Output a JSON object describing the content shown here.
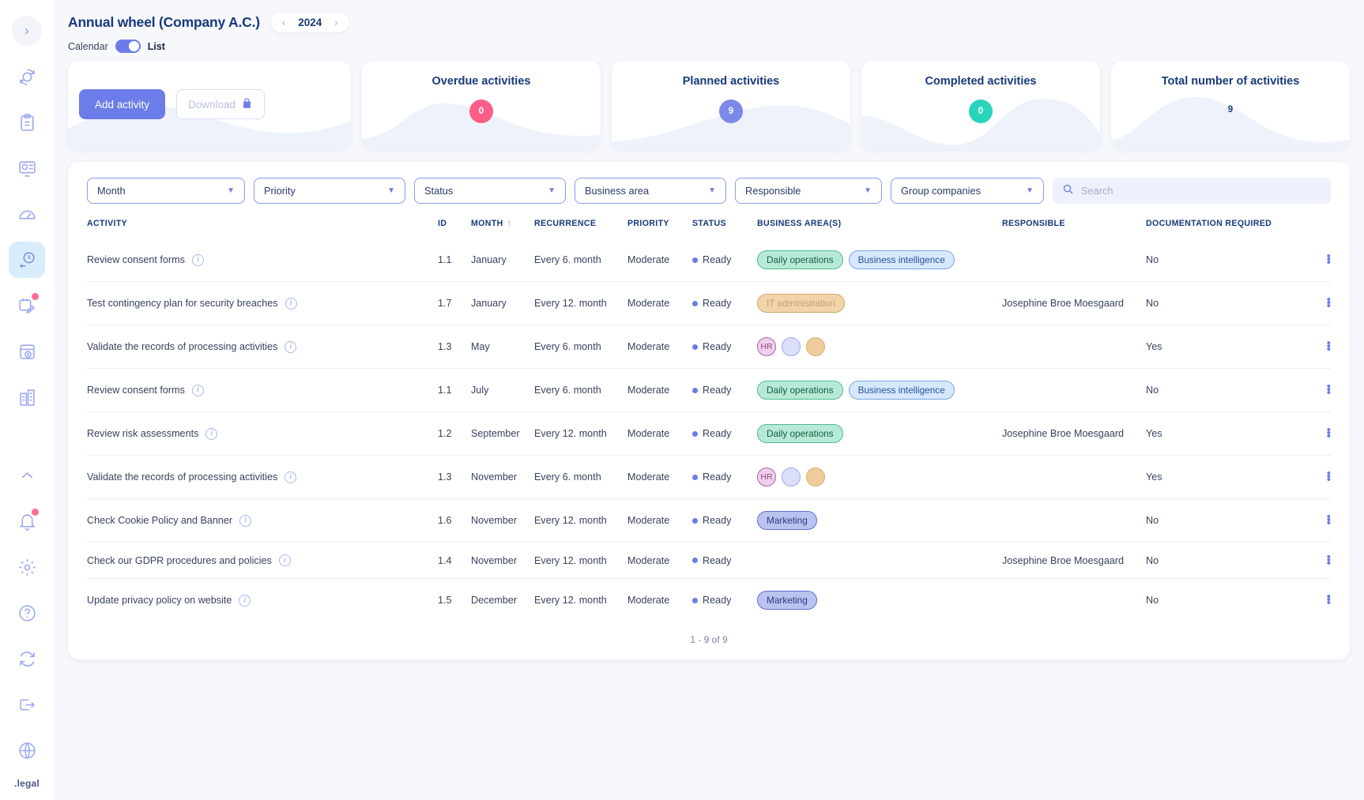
{
  "sidebar": {
    "collapse_label": "expand-sidebar",
    "items": [
      {
        "name": "sidebar-item-cycle",
        "icon": "refresh-globe-icon",
        "active": false,
        "badge": false
      },
      {
        "name": "sidebar-item-clipboard",
        "icon": "clipboard-icon",
        "active": false,
        "badge": false
      },
      {
        "name": "sidebar-item-dashboard",
        "icon": "monitor-chart-icon",
        "active": false,
        "badge": false
      },
      {
        "name": "sidebar-item-gauge",
        "icon": "gauge-icon",
        "active": false,
        "badge": false
      },
      {
        "name": "sidebar-item-annual-wheel",
        "icon": "clock-task-icon",
        "active": true,
        "badge": false
      },
      {
        "name": "sidebar-item-tasks",
        "icon": "calendar-edit-icon",
        "active": false,
        "badge": true
      },
      {
        "name": "sidebar-item-reports",
        "icon": "file-upload-icon",
        "active": false,
        "badge": false
      },
      {
        "name": "sidebar-item-company",
        "icon": "building-icon",
        "active": false,
        "badge": false
      }
    ],
    "bottom_items": [
      {
        "name": "sidebar-item-collapse-up",
        "icon": "chevron-up-icon",
        "badge": false
      },
      {
        "name": "sidebar-item-notifications",
        "icon": "bell-icon",
        "badge": true
      },
      {
        "name": "sidebar-item-settings",
        "icon": "gear-icon",
        "badge": false
      },
      {
        "name": "sidebar-item-help",
        "icon": "question-circle-icon",
        "badge": false
      },
      {
        "name": "sidebar-item-sync",
        "icon": "sync-icon",
        "badge": false
      },
      {
        "name": "sidebar-item-logout",
        "icon": "logout-icon",
        "badge": false
      },
      {
        "name": "sidebar-item-language",
        "icon": "globe-icon",
        "badge": false
      }
    ],
    "brand": ".legal"
  },
  "header": {
    "title": "Annual wheel (Company A.C.)",
    "year": "2024",
    "prev_arrow": "‹",
    "next_arrow": "›",
    "view_left_label": "Calendar",
    "view_right_label": "List"
  },
  "actions": {
    "add_activity": "Add activity",
    "download": "Download",
    "lock_icon": "lock-icon"
  },
  "stats": [
    {
      "title": "Overdue activities",
      "value": "0",
      "color": "#fb5f88",
      "style": "bubble"
    },
    {
      "title": "Planned activities",
      "value": "9",
      "color": "#7b8ae8",
      "style": "bubble"
    },
    {
      "title": "Completed activities",
      "value": "0",
      "color": "#2ad4bb",
      "style": "bubble"
    },
    {
      "title": "Total number of activities",
      "value": "9",
      "color": "#173a7a",
      "style": "plain"
    }
  ],
  "filters": {
    "month": "Month",
    "priority": "Priority",
    "status": "Status",
    "business_area": "Business area",
    "responsible": "Responsible",
    "group_companies": "Group companies",
    "chevron": "⌄"
  },
  "search": {
    "placeholder": "Search",
    "value": "",
    "icon": "search-icon"
  },
  "table": {
    "headers": {
      "activity": "ACTIVITY",
      "id": "ID",
      "month": "MONTH",
      "recurrence": "RECURRENCE",
      "priority": "PRIORITY",
      "status": "STATUS",
      "business_areas": "BUSINESS AREA(S)",
      "responsible": "RESPONSIBLE",
      "documentation": "DOCUMENTATION REQUIRED",
      "sort_icon": "↑"
    },
    "rows": [
      {
        "activity": "Review consent forms",
        "id": "1.1",
        "month": "January",
        "recurrence": "Every 6. month",
        "priority": "Moderate",
        "status": "Ready",
        "areas": [
          {
            "label": "Daily operations",
            "bg": "#b6ead7",
            "fg": "#15603f",
            "border": "#4dbb8d",
            "shape": "pill"
          },
          {
            "label": "Business intelligence",
            "bg": "#d6e8fd",
            "fg": "#2b4f9e",
            "border": "#7ba3e8",
            "shape": "pill"
          }
        ],
        "responsible": "",
        "documentation": "No"
      },
      {
        "activity": "Test contingency plan for security breaches",
        "id": "1.7",
        "month": "January",
        "recurrence": "Every 12. month",
        "priority": "Moderate",
        "status": "Ready",
        "areas": [
          {
            "label": "IT administration",
            "bg": "#f0d5ab",
            "fg": "#c9a06a",
            "border": "#cfa567",
            "shape": "pill"
          }
        ],
        "responsible": "Josephine Broe Moesgaard",
        "documentation": "No"
      },
      {
        "activity": "Validate the records of processing activities",
        "id": "1.3",
        "month": "May",
        "recurrence": "Every 6. month",
        "priority": "Moderate",
        "status": "Ready",
        "areas": [
          {
            "label": "HR",
            "bg": "#f0cfeb",
            "fg": "#8e4a86",
            "border": "#ab63a2",
            "shape": "circle"
          },
          {
            "label": "",
            "bg": "#dcdffa",
            "fg": "#dcdffa",
            "border": "#9aa8ee",
            "shape": "circle"
          },
          {
            "label": "",
            "bg": "#eecd9a",
            "fg": "#eecd9a",
            "border": "#d3ae74",
            "shape": "circle"
          }
        ],
        "responsible": "",
        "documentation": "Yes"
      },
      {
        "activity": "Review consent forms",
        "id": "1.1",
        "month": "July",
        "recurrence": "Every 6. month",
        "priority": "Moderate",
        "status": "Ready",
        "areas": [
          {
            "label": "Daily operations",
            "bg": "#b6ead7",
            "fg": "#15603f",
            "border": "#4dbb8d",
            "shape": "pill"
          },
          {
            "label": "Business intelligence",
            "bg": "#d6e8fd",
            "fg": "#2b4f9e",
            "border": "#7ba3e8",
            "shape": "pill"
          }
        ],
        "responsible": "",
        "documentation": "No"
      },
      {
        "activity": "Review risk assessments",
        "id": "1.2",
        "month": "September",
        "recurrence": "Every 12. month",
        "priority": "Moderate",
        "status": "Ready",
        "areas": [
          {
            "label": "Daily operations",
            "bg": "#b6ead7",
            "fg": "#15603f",
            "border": "#4dbb8d",
            "shape": "pill"
          }
        ],
        "responsible": "Josephine Broe Moesgaard",
        "documentation": "Yes"
      },
      {
        "activity": "Validate the records of processing activities",
        "id": "1.3",
        "month": "November",
        "recurrence": "Every 6. month",
        "priority": "Moderate",
        "status": "Ready",
        "areas": [
          {
            "label": "HR",
            "bg": "#f0cfeb",
            "fg": "#8e4a86",
            "border": "#ab63a2",
            "shape": "circle"
          },
          {
            "label": "",
            "bg": "#dcdffa",
            "fg": "#dcdffa",
            "border": "#9aa8ee",
            "shape": "circle"
          },
          {
            "label": "",
            "bg": "#eecd9a",
            "fg": "#eecd9a",
            "border": "#d3ae74",
            "shape": "circle"
          }
        ],
        "responsible": "",
        "documentation": "Yes"
      },
      {
        "activity": "Check Cookie Policy and Banner",
        "id": "1.6",
        "month": "November",
        "recurrence": "Every 12. month",
        "priority": "Moderate",
        "status": "Ready",
        "areas": [
          {
            "label": "Marketing",
            "bg": "#b9c3f0",
            "fg": "#2c3c78",
            "border": "#5d6fd0",
            "shape": "pill"
          }
        ],
        "responsible": "",
        "documentation": "No"
      },
      {
        "activity": "Check our GDPR procedures and policies",
        "id": "1.4",
        "month": "November",
        "recurrence": "Every 12. month",
        "priority": "Moderate",
        "status": "Ready",
        "areas": [],
        "responsible": "Josephine Broe Moesgaard",
        "documentation": "No"
      },
      {
        "activity": "Update privacy policy on website",
        "id": "1.5",
        "month": "December",
        "recurrence": "Every 12. month",
        "priority": "Moderate",
        "status": "Ready",
        "areas": [
          {
            "label": "Marketing",
            "bg": "#b9c3f0",
            "fg": "#2c3c78",
            "border": "#5d6fd0",
            "shape": "pill"
          }
        ],
        "responsible": "",
        "documentation": "No"
      }
    ],
    "pager": "1 - 9 of 9",
    "info_icon": "info-icon",
    "menu_icon": "kebab-menu-icon"
  }
}
